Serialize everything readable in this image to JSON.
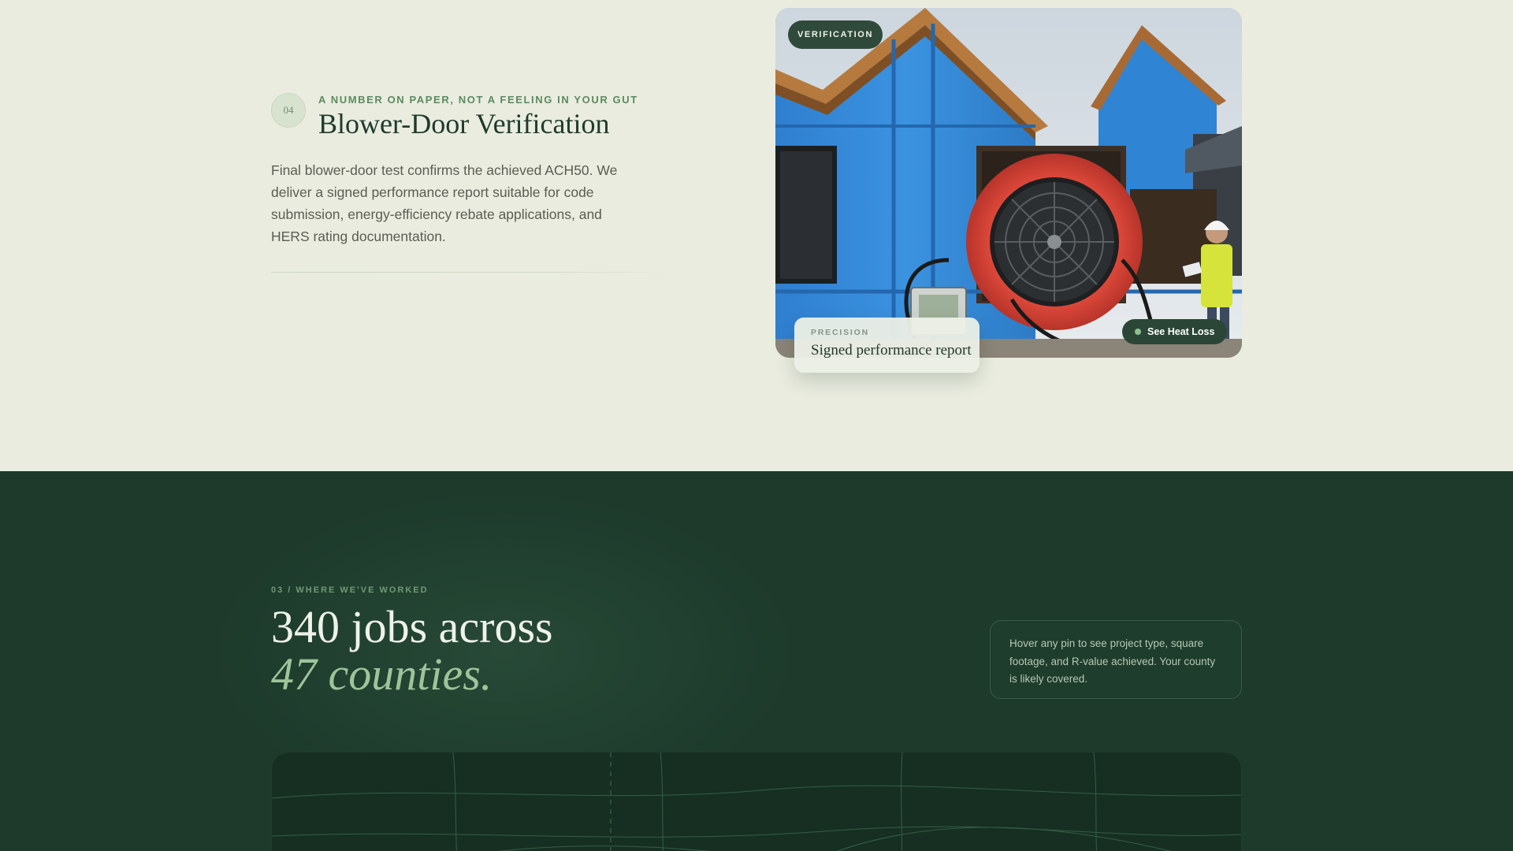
{
  "process_step": {
    "number": "04",
    "eyebrow": "A NUMBER ON PAPER, NOT A FEELING IN YOUR GUT",
    "title": "Blower-Door Verification",
    "body": "Final blower-door test confirms the achieved ACH50. We deliver a signed performance report suitable for code submission, energy-efficiency rebate applications, and HERS rating documentation.",
    "image": {
      "tag": "VERIFICATION",
      "info_label": "PRECISION",
      "info_value": "Signed performance report",
      "cta_label": "See Heat Loss"
    }
  },
  "coverage": {
    "eyebrow": "03 / WHERE WE'VE WORKED",
    "headline_line1": "340 jobs across",
    "headline_line2": "47 counties.",
    "hint": "Hover any pin to see project type, square footage, and R-value achieved. Your county is likely covered."
  },
  "colors": {
    "page_bg": "#e9ecdf",
    "dark_bg": "#1d3a2b",
    "accent_green": "#5c8a5f",
    "headline_italic": "#9ec49a",
    "pill_bg": "#2f4a3a"
  },
  "icons": {
    "cta_dot": "status-dot-icon"
  }
}
